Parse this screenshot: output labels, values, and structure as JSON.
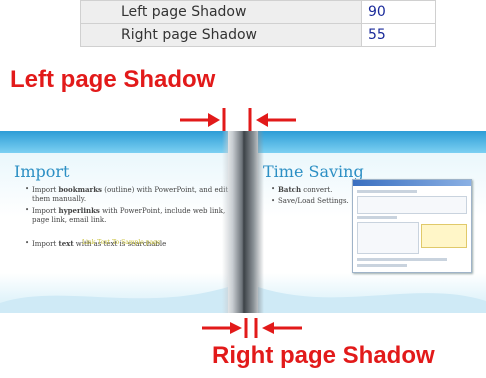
{
  "settings": {
    "rows": [
      {
        "label": "Left page Shadow",
        "value": "90"
      },
      {
        "label": "Right page Shadow",
        "value": "55"
      }
    ]
  },
  "annotations": {
    "left_label": "Left page Shadow",
    "right_label": "Right page Shadow",
    "color": "#e21a1a"
  },
  "left_page": {
    "title": "Import",
    "bullets": [
      [
        "Import ",
        "bookmarks",
        " (outline) with PowerPoint, and edit them manually."
      ],
      [
        "Import ",
        "hyperlinks",
        " with PowerPoint, include web link, page link, email link."
      ],
      [
        "Import ",
        "text",
        " with as text is searchable"
      ]
    ],
    "link_text": "Link Text To Sample page"
  },
  "right_page": {
    "title": "Time Saving",
    "bullets": [
      [
        "",
        "Batch",
        " convert."
      ],
      [
        "Save/Load Settings.",
        "",
        ""
      ]
    ]
  },
  "icons": {
    "arrow_color": "#e21a1a"
  }
}
